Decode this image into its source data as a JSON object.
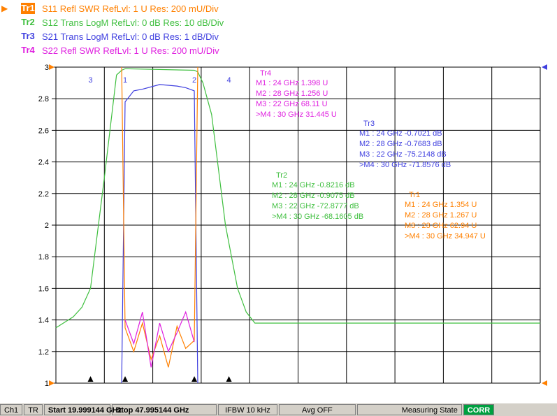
{
  "traces": [
    {
      "badge": "Tr1",
      "desc": "S11 Refl SWR RefLvl: 1  U Res: 200 mU/Div",
      "color": "#ff8000",
      "active": true
    },
    {
      "badge": "Tr2",
      "desc": "S12 Trans LogM RefLvl: 0  dB Res: 10  dB/Div",
      "color": "#3fbf3f",
      "active": false
    },
    {
      "badge": "Tr3",
      "desc": "S21 Trans LogM RefLvl: 0  dB Res: 1  dB/Div",
      "color": "#3f3fdf",
      "active": false
    },
    {
      "badge": "Tr4",
      "desc": "S22 Refl SWR RefLvl: 1  U Res: 200 mU/Div",
      "color": "#df1fdf",
      "active": false
    }
  ],
  "chart_data": {
    "type": "line",
    "y_ticks": [
      "3",
      "2.8",
      "2.6",
      "2.4",
      "2.2",
      "2",
      "1.8",
      "1.6",
      "1.4",
      "1.2",
      "1"
    ],
    "ylim": [
      1,
      3
    ],
    "x_start_ghz": 19.999144,
    "x_stop_ghz": 47.995144,
    "markers": [
      {
        "id": "1",
        "freq_ghz": 24
      },
      {
        "id": "2",
        "freq_ghz": 28
      },
      {
        "id": "3",
        "freq_ghz": 22
      },
      {
        "id": "4",
        "freq_ghz": 30
      }
    ],
    "marker_tables": [
      {
        "title": "Tr4",
        "color": "#df1fdf",
        "rows": [
          "M1  :  24 GHz  1.398  U",
          "M2  :  28 GHz  1.256  U",
          "M3  :  22 GHz  68.11  U",
          ">M4  :  30 GHz  31.445  U"
        ]
      },
      {
        "title": "Tr3",
        "color": "#3f3fdf",
        "rows": [
          "M1  :  24 GHz  -0.7021  dB",
          "M2  :  28 GHz  -0.7683  dB",
          "M3  :  22 GHz  -75.2148  dB",
          ">M4  :  30 GHz  -71.8576  dB"
        ]
      },
      {
        "title": "Tr2",
        "color": "#3fbf3f",
        "rows": [
          "M1  :  24 GHz  -0.8216  dB",
          "M2  :  28 GHz  -0.9075  dB",
          "M3  :  22 GHz  -72.8777  dB",
          ">M4  :  30 GHz  -68.1605  dB"
        ]
      },
      {
        "title": "Tr1",
        "color": "#ff8000",
        "rows": [
          "M1  :  24 GHz  1.354  U",
          "M2  :  28 GHz  1.267  U",
          "M3  :  23 GHz  62.94  U",
          ">M4  :  30 GHz  34.947  U"
        ]
      }
    ],
    "series": [
      {
        "name": "S12 Trans LogM",
        "color": "#3fbf3f",
        "x": [
          20,
          21,
          21.5,
          22,
          22.8,
          23.5,
          23.8,
          24,
          28,
          28.2,
          28.5,
          29,
          29.8,
          30.5,
          31,
          31.5,
          48
        ],
        "y": [
          1.35,
          1.42,
          1.48,
          1.6,
          2.3,
          2.95,
          2.98,
          2.99,
          2.98,
          2.97,
          2.9,
          2.7,
          2.0,
          1.6,
          1.45,
          1.38,
          1.38
        ]
      },
      {
        "name": "S21 Trans LogM",
        "color": "#3f3fdf",
        "x": [
          23.8,
          24,
          24.5,
          25,
          26,
          27,
          27.5,
          28,
          28.2
        ],
        "y": [
          1.0,
          2.78,
          2.85,
          2.86,
          2.89,
          2.88,
          2.87,
          2.85,
          1.0
        ]
      },
      {
        "name": "S11 Refl SWR",
        "color": "#ff8000",
        "x": [
          23.8,
          24,
          24.5,
          25,
          25.5,
          26,
          26.5,
          27,
          27.5,
          28,
          28.2
        ],
        "y": [
          3.0,
          1.35,
          1.2,
          1.38,
          1.15,
          1.3,
          1.1,
          1.36,
          1.22,
          1.27,
          3.0
        ]
      },
      {
        "name": "S22 Refl SWR",
        "color": "#df1fdf",
        "x": [
          24,
          24.5,
          25,
          25.5,
          26,
          26.5,
          27,
          27.5,
          28
        ],
        "y": [
          1.4,
          1.25,
          1.45,
          1.1,
          1.38,
          1.2,
          1.32,
          1.45,
          1.26
        ]
      }
    ]
  },
  "status": {
    "channel": "Ch1",
    "mode": "TR",
    "start": "Start 19.999144 GHz",
    "stop": "Stop 47.995144 GHz",
    "ifbw": "IFBW 10 kHz",
    "avg": "Avg OFF",
    "state": "Measuring State",
    "corr": "CORR"
  }
}
